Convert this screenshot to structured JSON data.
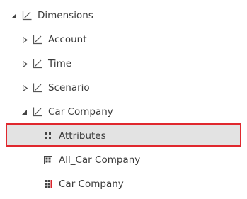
{
  "tree": {
    "root": {
      "label": "Dimensions",
      "icon": "dimension-icon",
      "expanded": true
    },
    "dimensions": [
      {
        "label": "Account",
        "icon": "dimension-icon",
        "expanded": false
      },
      {
        "label": "Time",
        "icon": "dimension-icon",
        "expanded": false
      },
      {
        "label": "Scenario",
        "icon": "dimension-icon",
        "expanded": false
      },
      {
        "label": "Car Company",
        "icon": "dimension-icon",
        "expanded": true
      }
    ],
    "car_company_children": [
      {
        "label": "Attributes",
        "icon": "attributes-icon",
        "selected": true
      },
      {
        "label": "All_Car Company",
        "icon": "grid-icon",
        "selected": false
      },
      {
        "label": "Car Company",
        "icon": "hierarchy-icon",
        "selected": false
      }
    ]
  },
  "colors": {
    "text": "#3a3a3a",
    "icon": "#555555",
    "selection_border": "#e0282e",
    "selection_background": "#e3e3e3",
    "hierarchy_accent": "#d9232a"
  }
}
